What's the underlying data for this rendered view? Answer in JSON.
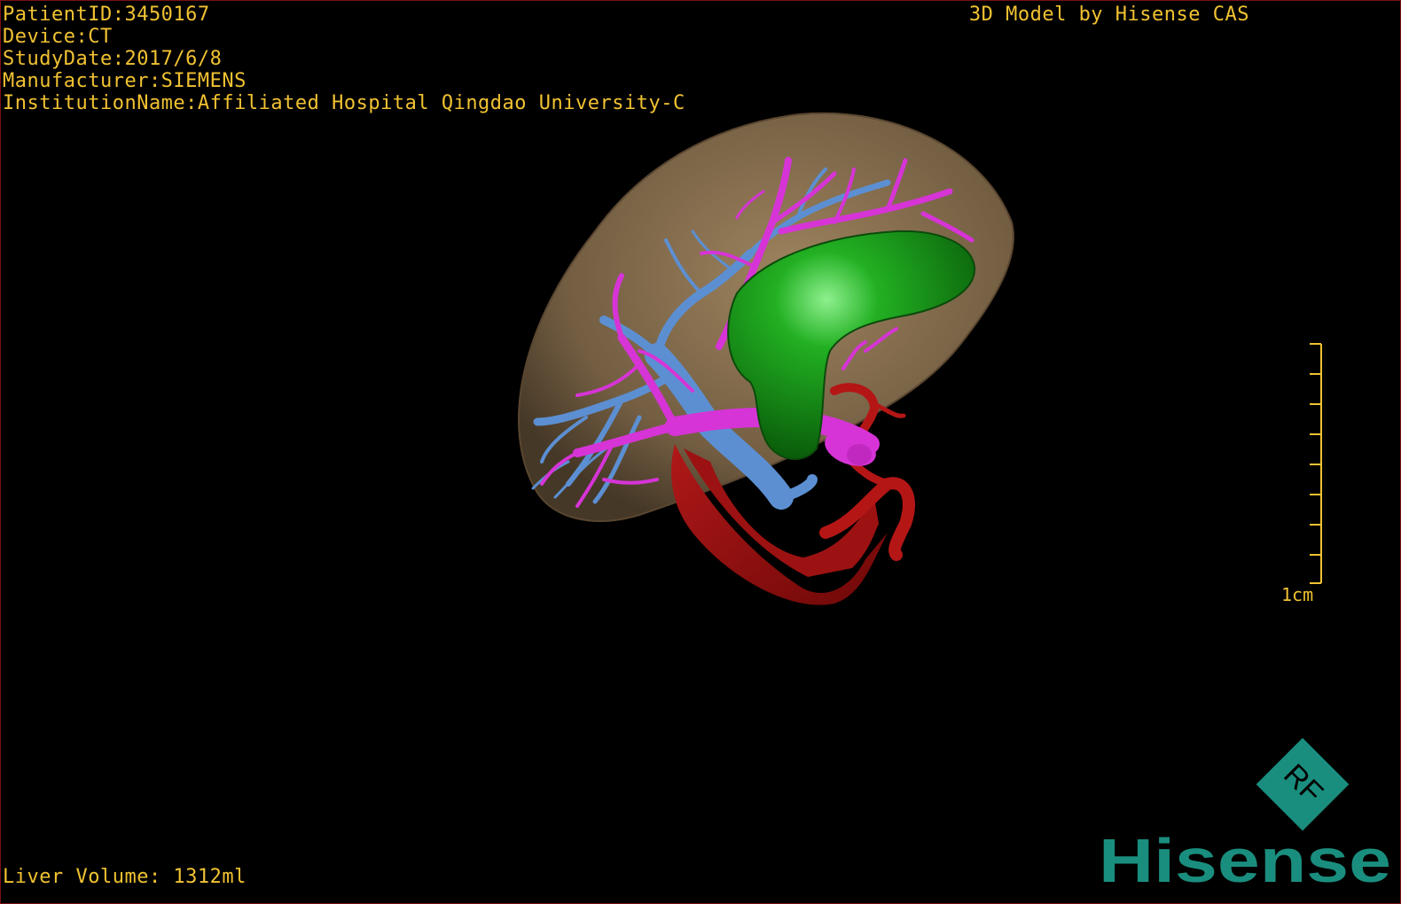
{
  "viewer": {
    "patient_id": "PatientID:3450167",
    "device": "Device:CT",
    "study_date": "StudyDate:2017/6/8",
    "manufacturer": "Manufacturer:SIEMENS",
    "institution": "InstitutionName:Affiliated Hospital Qingdao University-C",
    "brand_caption": "3D Model by Hisense CAS",
    "liver_volume": "Liver Volume: 1312ml",
    "scale_label": "1cm"
  },
  "logo": {
    "badge_text": "RF",
    "word": "Hisense"
  },
  "colors": {
    "overlay_text": "#f1c232",
    "liver": "#8a7050",
    "gallbladder": "#1f9b1f",
    "hepatic_vein": "#d030d0",
    "portal_vein": "#5a8ed0",
    "artery_ivc": "#a01010",
    "logo": "#1a8e7e",
    "border": "#7a0f14"
  },
  "icons": {
    "scale": "ruler-icon",
    "logo": "hisense-rf-logo"
  }
}
